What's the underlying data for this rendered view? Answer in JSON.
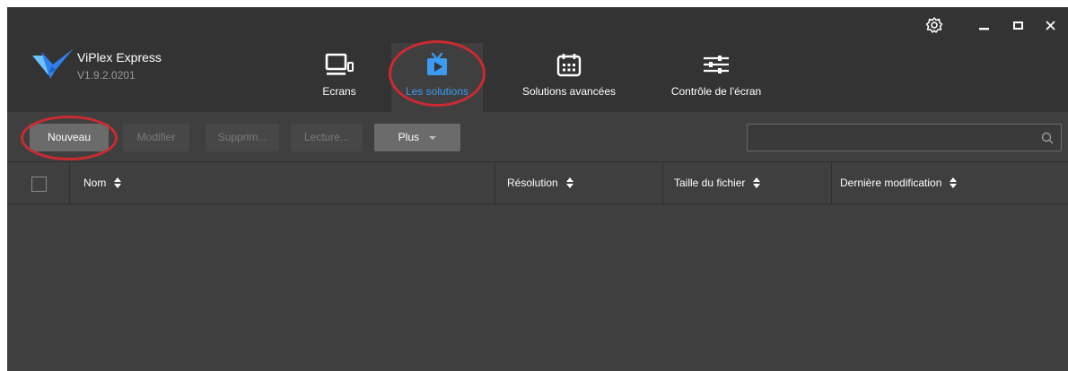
{
  "app": {
    "name": "ViPlex Express",
    "version": "V1.9.2.0201"
  },
  "nav": {
    "tabs": [
      {
        "label": "Ecrans",
        "icon": "screen-icon"
      },
      {
        "label": "Les solutions",
        "icon": "play-tv-icon",
        "active": true
      },
      {
        "label": "Solutions avancées",
        "icon": "calendar-icon"
      },
      {
        "label": "Contrôle de l'écran",
        "icon": "sliders-icon"
      }
    ]
  },
  "window_controls": [
    "settings-icon",
    "minimize-icon",
    "maximize-icon",
    "close-icon"
  ],
  "toolbar": {
    "new_label": "Nouveau",
    "edit_label": "Modifier",
    "delete_label": "Supprim...",
    "play_label": "Lecture...",
    "more_label": "Plus",
    "search_value": "",
    "search_placeholder": ""
  },
  "table": {
    "columns": {
      "name": "Nom",
      "resolution": "Résolution",
      "filesize": "Taille du fichier",
      "modified": "Dernière modification"
    },
    "rows": []
  },
  "colors": {
    "background": "#3f3f3f",
    "header": "#333333",
    "accent": "#3a9bf0",
    "annotation": "#cc2a31"
  }
}
